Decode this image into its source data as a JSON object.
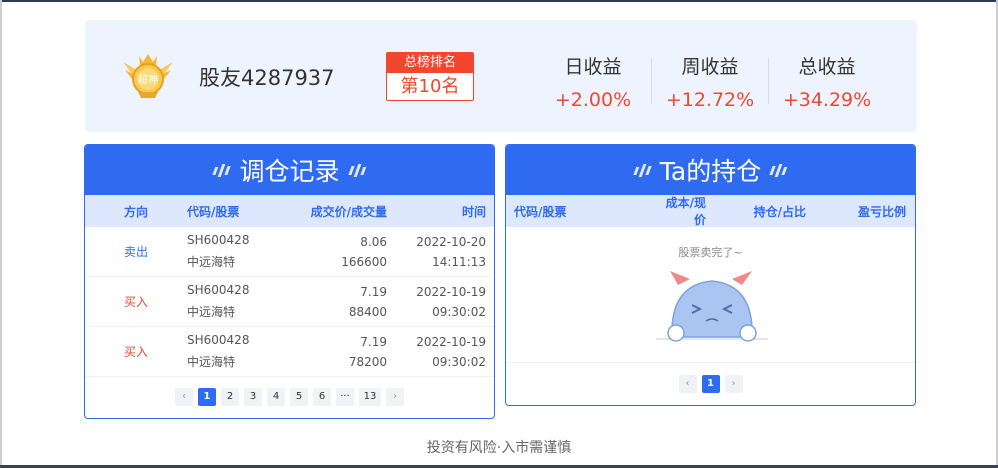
{
  "profile": {
    "medal_text": "超神",
    "username": "股友4287937",
    "rank_label": "总榜排名",
    "rank_value": "第10名",
    "stats": [
      {
        "label": "日收益",
        "value": "+2.00%"
      },
      {
        "label": "周收益",
        "value": "+12.72%"
      },
      {
        "label": "总收益",
        "value": "+34.29%"
      }
    ]
  },
  "trades": {
    "title": "调仓记录",
    "columns": [
      "方向",
      "代码/股票",
      "成交价/成交量",
      "时间"
    ],
    "rows": [
      {
        "direction": "卖出",
        "code": "SH600428",
        "name": "中远海特",
        "price": "8.06",
        "volume": "166600",
        "date": "2022-10-20",
        "time": "14:11:13"
      },
      {
        "direction": "买入",
        "code": "SH600428",
        "name": "中远海特",
        "price": "7.19",
        "volume": "88400",
        "date": "2022-10-19",
        "time": "09:30:02"
      },
      {
        "direction": "买入",
        "code": "SH600428",
        "name": "中远海特",
        "price": "7.19",
        "volume": "78200",
        "date": "2022-10-19",
        "time": "09:30:02"
      }
    ],
    "pager": {
      "prev": "‹",
      "pages": [
        "1",
        "2",
        "3",
        "4",
        "5",
        "6"
      ],
      "ellipsis": "···",
      "last": "13",
      "next": "›"
    }
  },
  "holdings": {
    "title": "Ta的持仓",
    "columns": [
      "代码/股票",
      "成本/现价",
      "持仓/占比",
      "盈亏比例"
    ],
    "empty_text": "股票卖完了~",
    "pager": {
      "prev": "‹",
      "page": "1",
      "next": "›"
    }
  },
  "footer": "投资有风险·入市需谨慎",
  "colors": {
    "accent": "#2f6bf0",
    "gain": "#f2462e",
    "header_bg": "#eef4ff"
  }
}
